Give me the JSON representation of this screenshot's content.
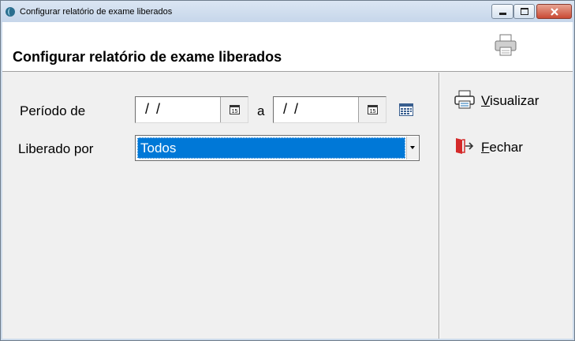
{
  "window": {
    "title": "Configurar relatório de exame liberados",
    "minimize_icon": "minimize-icon",
    "maximize_icon": "maximize-icon",
    "close_icon": "close-icon"
  },
  "header": {
    "title": "Configurar relatório de exame liberados",
    "icon": "printer-icon"
  },
  "form": {
    "period_label": "Período de",
    "date_from": "/ /",
    "date_separator": "a",
    "date_to": "/ /",
    "calendar_icon": "calendar-icon",
    "released_by_label": "Liberado por",
    "released_by_value": "Todos"
  },
  "actions": {
    "preview": {
      "mnemonic": "V",
      "rest": "isualizar",
      "icon": "printer-icon"
    },
    "close": {
      "mnemonic": "F",
      "rest": "echar",
      "icon": "exit-door-icon"
    }
  },
  "colors": {
    "selection": "#0078d7",
    "window_bg": "#f0f0f0",
    "close_button": "#c94a34"
  }
}
